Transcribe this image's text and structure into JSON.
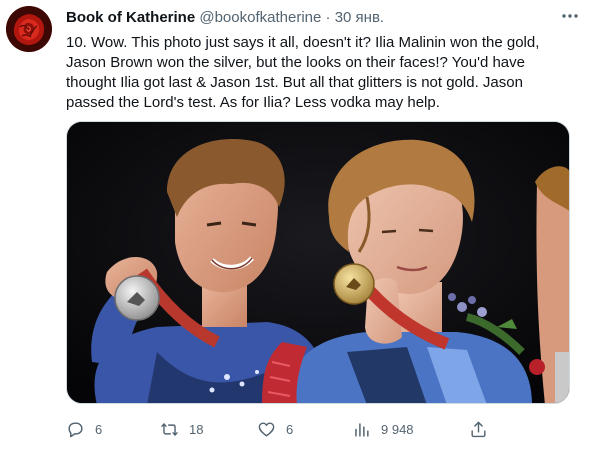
{
  "tweet": {
    "author_name": "Book of Katherine",
    "author_handle": "@bookofkatherine",
    "separator": "·",
    "timestamp": "30 янв.",
    "text": "10. Wow. This photo just says it all, doesn't it? Ilia Malinin won the gold, Jason Brown won the silver, but the looks on their faces!? You'd have thought Ilia got last & Jason 1st. But all that glitters is not gold. Jason passed the Lord's test. As for Ilia? Less vodka may help.",
    "more_icon": "more-horizontal-icon"
  },
  "actions": {
    "reply": {
      "icon": "reply-icon",
      "count": "6"
    },
    "retweet": {
      "icon": "retweet-icon",
      "count": "18"
    },
    "like": {
      "icon": "heart-icon",
      "count": "6"
    },
    "views": {
      "icon": "analytics-icon",
      "count": "9 948"
    },
    "share": {
      "icon": "share-icon"
    }
  },
  "colors": {
    "text": "#0f1419",
    "secondary": "#536471",
    "border": "#cfd9de"
  }
}
